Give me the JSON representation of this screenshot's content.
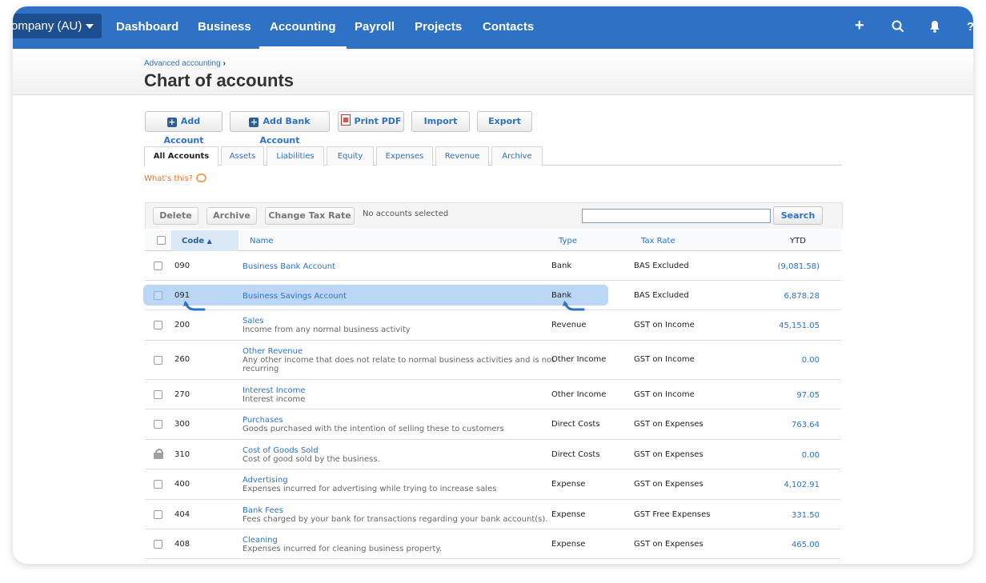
{
  "topnav": {
    "org_label": "ompany (AU)",
    "items": [
      {
        "label": "Dashboard"
      },
      {
        "label": "Business"
      },
      {
        "label": "Accounting"
      },
      {
        "label": "Payroll"
      },
      {
        "label": "Projects"
      },
      {
        "label": "Contacts"
      }
    ],
    "active": "Accounting",
    "icons": [
      "plus-icon",
      "search-icon",
      "bell-icon",
      "help-icon"
    ],
    "help_glyph": "?",
    "plus_glyph": "+"
  },
  "header": {
    "breadcrumb": "Advanced accounting",
    "breadcrumb_arrow": "›",
    "title": "Chart of accounts"
  },
  "actions": {
    "add_account": "Add Account",
    "add_bank_account": "Add Bank Account",
    "print_pdf": "Print PDF",
    "import": "Import",
    "export": "Export",
    "plus_glyph": "+"
  },
  "tabs": [
    "All Accounts",
    "Assets",
    "Liabilities",
    "Equity",
    "Expenses",
    "Revenue",
    "Archive"
  ],
  "whats_this": "What's this?",
  "toolbar": {
    "delete": "Delete",
    "archive": "Archive",
    "change_tax_rate": "Change Tax Rate",
    "status": "No accounts selected",
    "search_placeholder": "",
    "search": "Search"
  },
  "table": {
    "columns": {
      "code": "Code",
      "sort_glyph": "▲",
      "name": "Name",
      "type": "Type",
      "tax_rate": "Tax Rate",
      "ytd": "YTD"
    },
    "rows": [
      {
        "code": "090",
        "name": "Business Bank Account",
        "desc": "",
        "type": "Bank",
        "tax": "BAS Excluded",
        "ytd": "(9,081.58)"
      },
      {
        "code": "091",
        "name": "Business Savings Account",
        "desc": "",
        "type": "Bank",
        "tax": "BAS Excluded",
        "ytd": "6,878.28"
      },
      {
        "code": "200",
        "name": "Sales",
        "desc": "Income from any normal business activity",
        "type": "Revenue",
        "tax": "GST on Income",
        "ytd": "45,151.05"
      },
      {
        "code": "260",
        "name": "Other Revenue",
        "desc": "Any other income that does not relate to normal business activities and is not",
        "desc2": "recurring",
        "type": "Other Income",
        "tax": "GST on Income",
        "ytd": "0.00"
      },
      {
        "code": "270",
        "name": "Interest Income",
        "desc": "Interest income",
        "type": "Other Income",
        "tax": "GST on Income",
        "ytd": "97.05"
      },
      {
        "code": "300",
        "name": "Purchases",
        "desc": "Goods purchased with the intention of selling these to customers",
        "type": "Direct Costs",
        "tax": "GST on Expenses",
        "ytd": "763.64"
      },
      {
        "code": "310",
        "name": "Cost of Goods Sold",
        "desc": "Cost of good sold by the business.",
        "type": "Direct Costs",
        "tax": "GST on Expenses",
        "ytd": "0.00"
      },
      {
        "code": "400",
        "name": "Advertising",
        "desc": "Expenses incurred for advertising while trying to increase sales",
        "type": "Expense",
        "tax": "GST on Expenses",
        "ytd": "4,102.91"
      },
      {
        "code": "404",
        "name": "Bank Fees",
        "desc": "Fees charged by your bank for transactions regarding your bank account(s).",
        "type": "Expense",
        "tax": "GST Free Expenses",
        "ytd": "331.50"
      },
      {
        "code": "408",
        "name": "Cleaning",
        "desc": "Expenses incurred for cleaning business property.",
        "type": "Expense",
        "tax": "GST on Expenses",
        "ytd": "465.00"
      }
    ]
  },
  "colors": {
    "brand": "#2d72c4",
    "highlight": "#bcd6f5",
    "link": "#2d72c4"
  }
}
